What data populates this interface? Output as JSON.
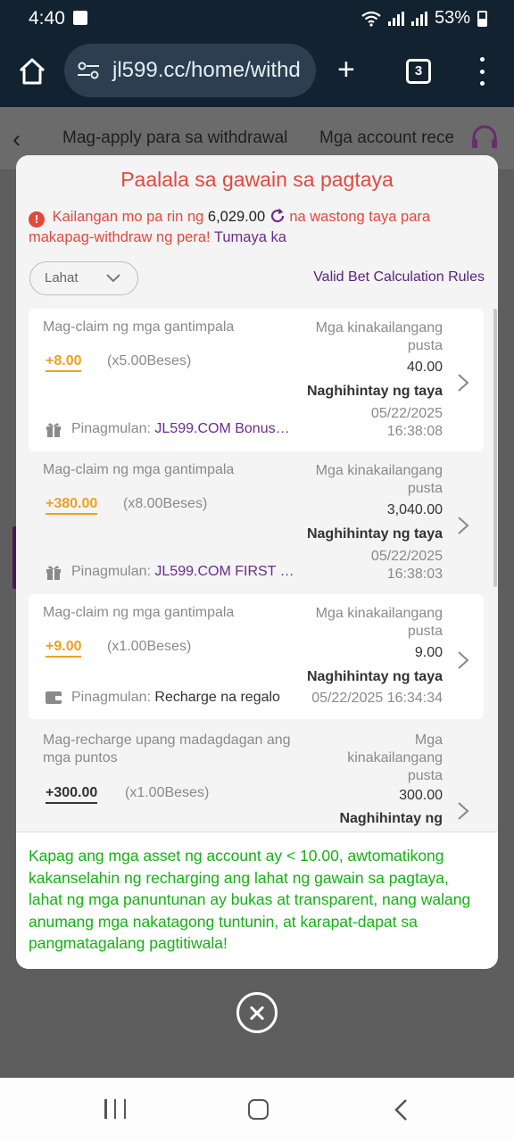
{
  "status_bar": {
    "time": "4:40",
    "battery": "53%"
  },
  "browser": {
    "url": "jl599.cc/home/withd",
    "tab_count": "3"
  },
  "page": {
    "nav_title": "Mag-apply para sa withdrawal",
    "nav_title2": "Mga account recei"
  },
  "modal": {
    "title": "Paalala sa gawain sa pagtaya",
    "notice_prefix": "Kailangan mo pa rin ng",
    "notice_amount": "6,029.00",
    "notice_suffix": "na wastong taya para makapag-withdraw ng pera!",
    "notice_link": "Tumaya ka",
    "filter_value": "Lahat",
    "rules_link": "Valid Bet Calculation Rules",
    "footer_note": "Kapag ang mga asset ng account ay < 10.00, awtomatikong kakanselahin ng recharging ang lahat ng gawain sa pagtaya, lahat ng mga panuntunan ay bukas at transparent, nang walang anumang mga nakatagong tuntunin, at karapat-dapat sa pangmatagalang pagtitiwala!"
  },
  "cards": [
    {
      "label": "Mag-claim ng mga gantimpala",
      "bonus": "+8.00",
      "multiplier": "(x5.00Beses)",
      "req_label": "Mga kinakailangang pusta",
      "req_value": "40.00",
      "status": "Naghihintay ng taya",
      "source_label": "Pinagmulan:",
      "source_name": "JL599.COM Bonus…",
      "date": "05/22/2025",
      "time": "16:38:08"
    },
    {
      "label": "Mag-claim ng mga gantimpala",
      "bonus": "+380.00",
      "multiplier": "(x8.00Beses)",
      "req_label": "Mga kinakailangang pusta",
      "req_value": "3,040.00",
      "status": "Naghihintay ng taya",
      "source_label": "Pinagmulan:",
      "source_name": "JL599.COM FIRST …",
      "date": "05/22/2025",
      "time": "16:38:03"
    },
    {
      "label": "Mag-claim ng mga gantimpala",
      "bonus": "+9.00",
      "multiplier": "(x1.00Beses)",
      "req_label": "Mga kinakailangang pusta",
      "req_value": "9.00",
      "status": "Naghihintay ng taya",
      "source_label": "Pinagmulan:",
      "source_name": "Recharge na regalo",
      "datetime": "05/22/2025 16:34:34"
    },
    {
      "label": "Mag-recharge upang madagdagan ang mga puntos",
      "bonus": "+300.00",
      "multiplier": "(x1.00Beses)",
      "req_label": "Mga kinakailangang pusta",
      "req_value": "300.00",
      "status": "Naghihintay ng"
    }
  ],
  "icons": [
    "image-icon",
    "wifi-icon",
    "signal-icon",
    "battery-icon",
    "home-icon",
    "site-settings-icon",
    "plus-icon",
    "tabs-icon",
    "more-vert-icon",
    "back-arrow-icon",
    "headset-icon",
    "warning-icon",
    "refresh-icon",
    "chevron-down-icon",
    "chevron-right-icon",
    "gift-icon",
    "wallet-icon",
    "close-icon"
  ],
  "colors": {
    "title_red": "#e1493d",
    "accent_purple": "#6a2c8c",
    "bonus_orange": "#f0a020",
    "note_green": "#12b312"
  }
}
